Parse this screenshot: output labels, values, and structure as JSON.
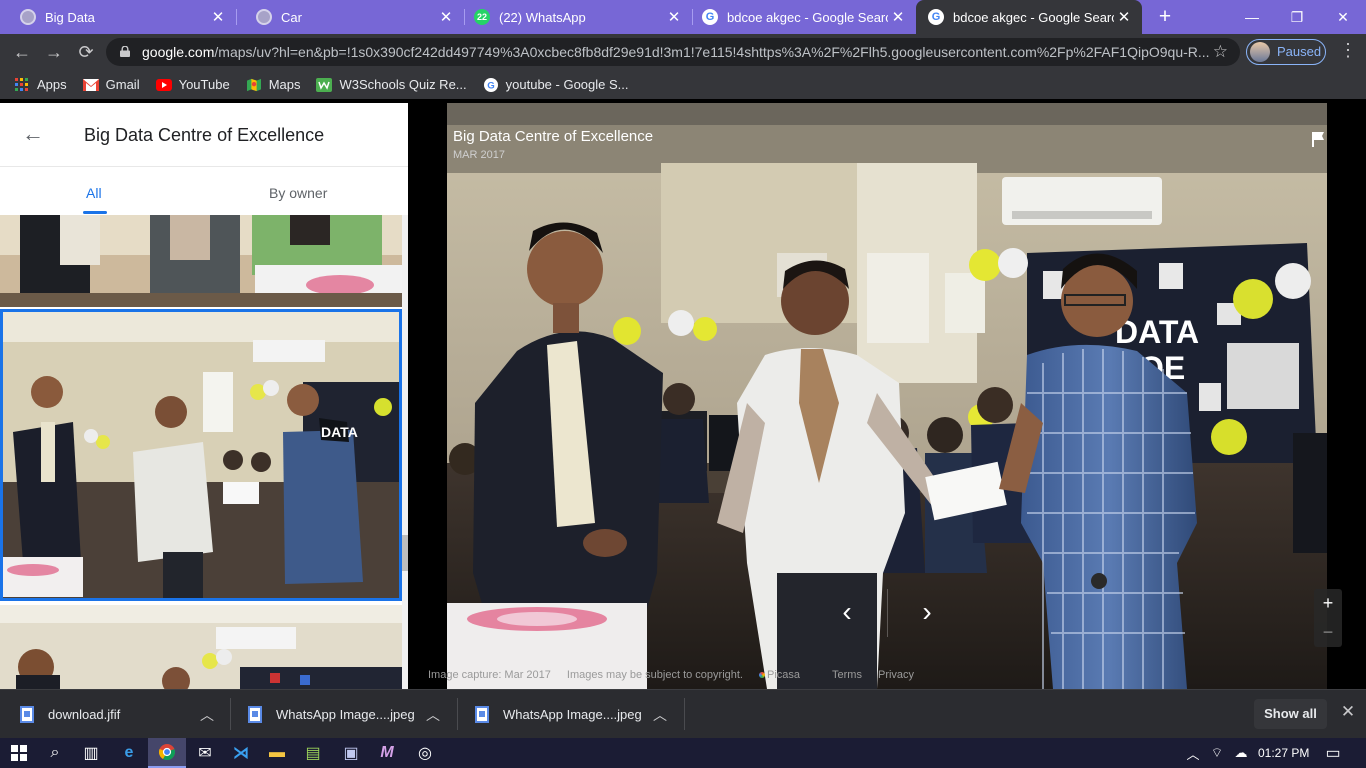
{
  "browser": {
    "tabs": [
      {
        "title": "Big Data",
        "favicon": "globe-icon"
      },
      {
        "title": "Car",
        "favicon": "globe-icon"
      },
      {
        "title": "(22) WhatsApp",
        "favicon": "whatsapp-icon",
        "badge": "22"
      },
      {
        "title": "bdcoe akgec - Google Search",
        "favicon": "google-icon"
      },
      {
        "title": "bdcoe akgec - Google Search",
        "favicon": "google-icon",
        "active": true
      }
    ],
    "url_host": "google.com",
    "url_rest": "/maps/uv?hl=en&pb=!1s0x390cf242dd497749%3A0xcbec8fb8df29e91d!3m1!7e115!4shttps%3A%2F%2Flh5.googleusercontent.com%2Fp%2FAF1QipO9qu-R...",
    "profile_status": "Paused",
    "bookmarks": [
      {
        "label": "Apps",
        "icon": "apps-grid-icon"
      },
      {
        "label": "Gmail",
        "icon": "gmail-icon"
      },
      {
        "label": "YouTube",
        "icon": "youtube-icon"
      },
      {
        "label": "Maps",
        "icon": "maps-icon"
      },
      {
        "label": "W3Schools Quiz Re...",
        "icon": "w3schools-icon"
      },
      {
        "label": "youtube - Google S...",
        "icon": "google-icon"
      }
    ]
  },
  "sidebar": {
    "title": "Big Data Centre of Excellence",
    "tabs": [
      "All",
      "By owner"
    ],
    "active_tab": "All"
  },
  "viewer": {
    "title": "Big Data Centre of Excellence",
    "date": "MAR 2017",
    "credits": {
      "capture": "Image capture: Mar 2017",
      "copyright": "Images may be subject to copyright.",
      "source": "Picasa",
      "terms": "Terms",
      "privacy": "Privacy"
    }
  },
  "downloads": {
    "items": [
      "download.jfif",
      "WhatsApp Image....jpeg",
      "WhatsApp Image....jpeg"
    ],
    "show_all": "Show all"
  },
  "taskbar": {
    "time": "01:27 PM"
  },
  "colors": {
    "tab_strip": "#7767d6",
    "chrome_dark": "#35363a",
    "accent_blue": "#1a73e8",
    "taskbar": "#1b1c34"
  }
}
